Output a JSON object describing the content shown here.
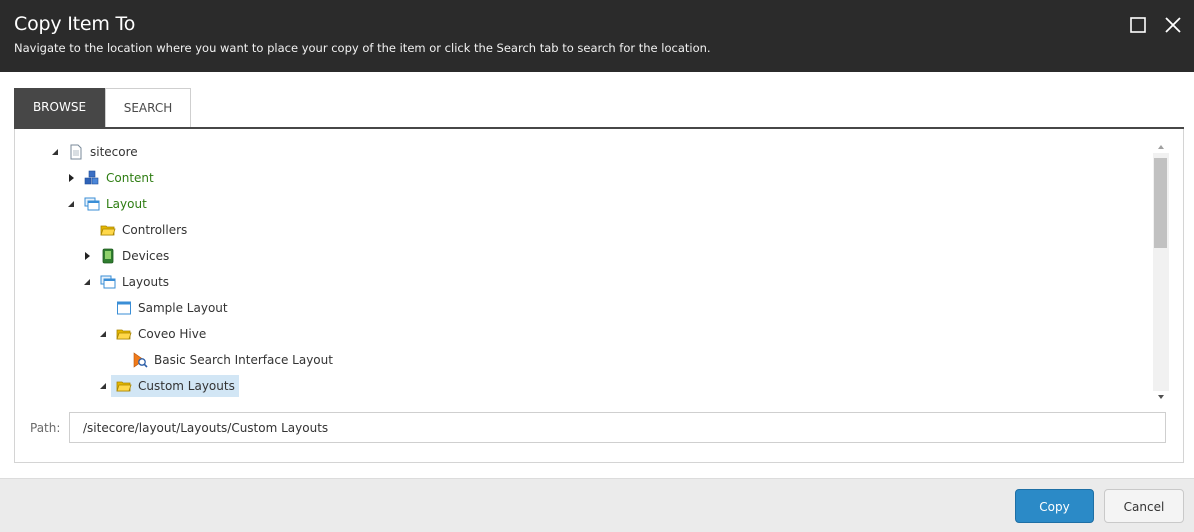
{
  "dialog": {
    "title": "Copy Item To",
    "subtitle": "Navigate to the location where you want to place your copy of the item or click the Search tab to search for the location."
  },
  "tabs": [
    {
      "label": "BROWSE",
      "active": true
    },
    {
      "label": "SEARCH",
      "active": false
    }
  ],
  "tree": [
    {
      "label": "sitecore",
      "icon": "document-icon",
      "expanded": true,
      "level": 0
    },
    {
      "label": "Content",
      "icon": "content-cubes-icon",
      "expanded": false,
      "level": 1,
      "color": "#2e7d12"
    },
    {
      "label": "Layout",
      "icon": "layout-windows-icon",
      "expanded": true,
      "level": 1,
      "color": "#2e7d12"
    },
    {
      "label": "Controllers",
      "icon": "folder-icon",
      "level": 2
    },
    {
      "label": "Devices",
      "icon": "device-icon",
      "expanded": false,
      "level": 2
    },
    {
      "label": "Layouts",
      "icon": "layout-windows-icon",
      "expanded": true,
      "level": 2
    },
    {
      "label": "Sample Layout",
      "icon": "layout-window-icon",
      "level": 3
    },
    {
      "label": "Coveo Hive",
      "icon": "folder-icon",
      "expanded": true,
      "level": 3
    },
    {
      "label": "Basic Search Interface Layout",
      "icon": "coveo-search-icon",
      "level": 4
    },
    {
      "label": "Custom Layouts",
      "icon": "folder-icon",
      "expanded": true,
      "level": 3,
      "selected": true
    }
  ],
  "path": {
    "label": "Path:",
    "value": "/sitecore/layout/Layouts/Custom Layouts"
  },
  "buttons": {
    "copy": "Copy",
    "cancel": "Cancel"
  },
  "colors": {
    "titlebar": "#2b2b2b",
    "primary": "#2b8ac7",
    "selection": "#d2e6f5"
  }
}
